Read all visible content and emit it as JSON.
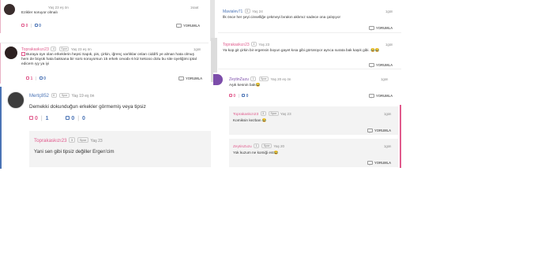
{
  "colors": {
    "pink": "#e05a8c",
    "blue": "#4a73b5",
    "accent_bar": "#e05a8c",
    "muted": "#888"
  },
  "reply_label": "YORUMLA",
  "left": {
    "c1": {
      "text": "Ezikler soruyor olmalı",
      "meta": "Yaş 23 eş ön",
      "time": "1saat",
      "up": "0",
      "down": "0"
    },
    "c2": {
      "user": "Toprakaskızı23",
      "badge": "4",
      "badge2": "Spor",
      "age": "Yaş 23 eş ön",
      "time": "1gün",
      "text": "Buraya üye olan erkeklerin hepsi Sapık, pis, çirkin, iğrenç varlıklar onları ciddi'li ye alman hata olmuş hem de büyük hata baksana bir sorü soruyorsun 15 erkek cevabı 6 kiz kekooo dolu bu site üyeliğimi iptal edicem ıyy ya iyi",
      "up": "1",
      "down": "0"
    },
    "c3": {
      "user": "Mertç852",
      "badge": "6",
      "badge2": "Spor",
      "age": "Yaş 19 eş ön",
      "text": "Demekki dokunduğun erkekler görmemiş veya tipsiz",
      "up": "0",
      "upcount": "1",
      "down": "0",
      "downcount": "0"
    },
    "c4": {
      "user": "Toprakaskızı23",
      "badge": "3",
      "badge2": "Spor",
      "age": "Yaş 23",
      "text": "Yani sen gibi tipsiz değiller Ergen'cim"
    }
  },
  "right": {
    "c1": {
      "user": "Mavialev71",
      "badge": "6",
      "age": "Yaş 24",
      "time": "1gün",
      "text": "İlk önce her şeyi cinselliğe çekmeyi bırakın aklımız sadece ona çalışıyor"
    },
    "c2": {
      "user": "Toprakaskızı23",
      "badge": "4",
      "age": "Yaş 23",
      "time": "1gün",
      "text": "Ya kop git çirkin bir ergensin boyun gayet kısa gibi görünüyor ayrıca surata bak kaşık gibi. 😂😂"
    },
    "c3": {
      "user": "ZeytinZuzu",
      "badge": "1",
      "badge2": "Spor",
      "age": "Yaş 20 eş ön",
      "time": "1gün",
      "text": "Aşık kesnin bak😂",
      "up": "0",
      "down": "0"
    },
    "c4": {
      "user": "Toprakaskızı23",
      "badge": "3",
      "badge2": "Spor",
      "age": "Yaş 23",
      "time": "1gün",
      "text": "Komiksin kezban 😂"
    },
    "c5": {
      "user": "ZeytinZuzu",
      "badge": "1",
      "badge2": "Spor",
      "age": "Yaş 20",
      "time": "1gün",
      "text": "Yok kuzum ne komiği est😂"
    }
  }
}
